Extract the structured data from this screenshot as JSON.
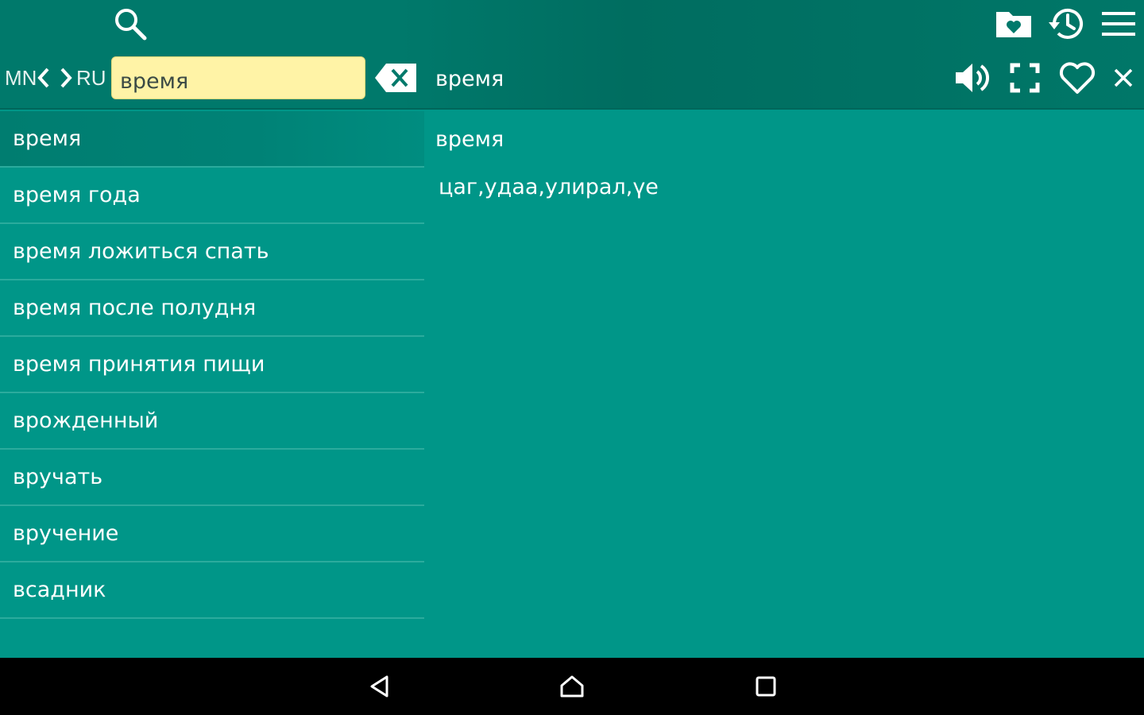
{
  "header": {
    "lang_source": "MN",
    "lang_target": "RU",
    "search": {
      "value": "время",
      "placeholder": ""
    },
    "current_word": "время",
    "icons": {
      "search": "search-icon",
      "favorites_folder": "favorites-folder-icon",
      "history": "history-icon",
      "menu": "menu-icon",
      "clear": "backspace-clear-icon",
      "speak": "speaker-icon",
      "fullscreen": "fullscreen-icon",
      "favorite": "heart-icon",
      "close": "close-icon"
    }
  },
  "word_list": {
    "selected_index": 0,
    "items": [
      "время",
      "время года",
      "время ложиться спать",
      "время после полудня",
      "время принятия пищи",
      "врожденный",
      "вручать",
      "вручение",
      "всадник"
    ]
  },
  "translation": {
    "headword": "время",
    "text": "цаг,удаа,улирал,үе"
  },
  "colors": {
    "app_bar": "#00796b",
    "background": "#009688",
    "selected_row": "#007d70",
    "search_field": "#fff3a6",
    "nav_bar": "#000000"
  },
  "navigation": {
    "back": "back-icon",
    "home": "home-icon",
    "recent": "recent-apps-icon"
  }
}
